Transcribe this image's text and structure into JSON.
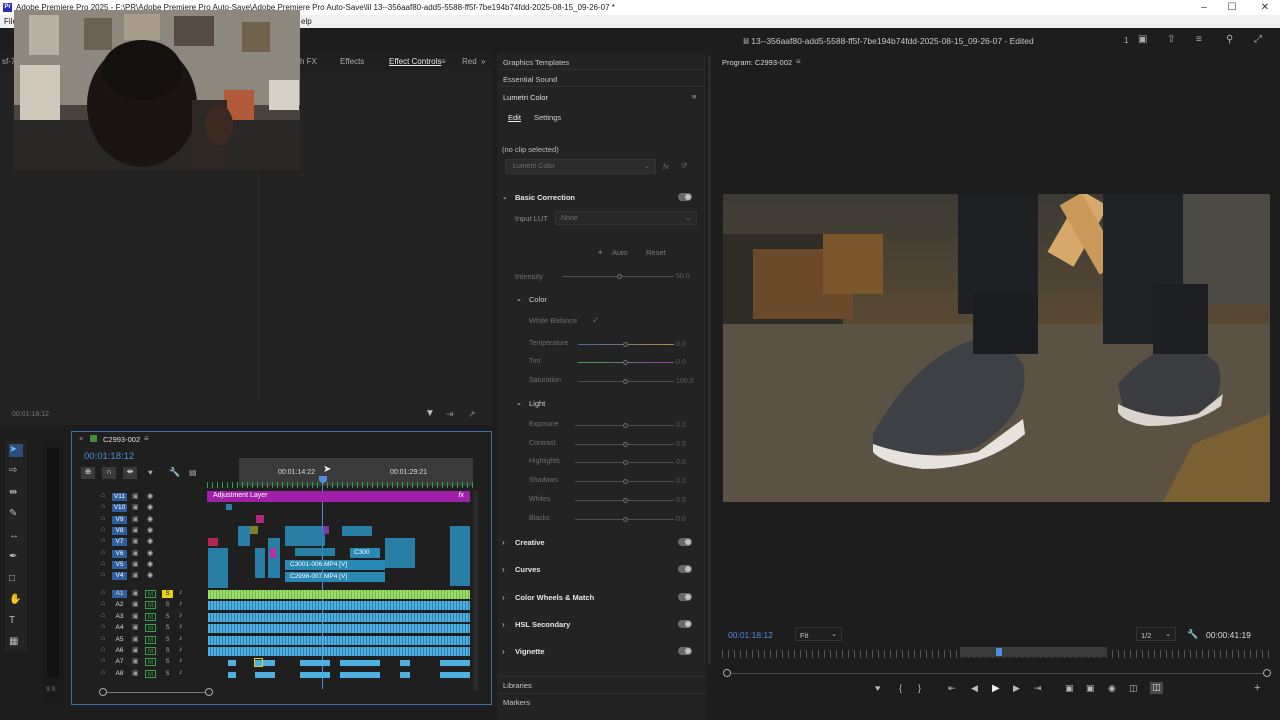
{
  "window": {
    "title": "Adobe Premiere Pro 2025 - F:\\PR\\Adobe Premiere Pro Auto-Save\\Adobe Premiere Pro Auto-Save\\lil 13--356aaf80-add5-5588-ff5f-7be194b74fdd-2025-08-15_09-26-07 *",
    "app_icon": "Pr",
    "minimize": "–",
    "maximize": "☐",
    "close": "✕"
  },
  "menu": {
    "file": "File",
    "help": "elp"
  },
  "project": {
    "title": "lil 13--356aaf80-add5-5588-ff5f-7be194b74fdd-2025-08-15_09-26-07 - Edited",
    "workspace_number": "1"
  },
  "left_panel": {
    "tabs": {
      "cut_left": "sf-7b",
      "fx": "h FX",
      "effects": "Effects",
      "effect_controls": "Effect Controls",
      "red": "Red"
    },
    "timecode": "00:01:18:12"
  },
  "lumetri": {
    "tab_graphics": "Graphics Templates",
    "tab_sound": "Essential Sound",
    "title": "Lumetri Color",
    "tab_edit": "Edit",
    "tab_settings": "Settings",
    "no_clip": "(no clip selected)",
    "dropdown": "Lumetri Color",
    "basic_correction": "Basic Correction",
    "input_lut_label": "Input LUT",
    "input_lut_value": "None",
    "auto": "Auto",
    "reset": "Reset",
    "intensity_label": "Intensity",
    "intensity_value": "50.0",
    "color_section": "Color",
    "white_balance": "White Balance",
    "color_sliders": [
      {
        "label": "Temperature",
        "value": "0.0"
      },
      {
        "label": "Tint",
        "value": "0.0"
      },
      {
        "label": "Saturation",
        "value": "100.0"
      }
    ],
    "light_section": "Light",
    "light_sliders": [
      {
        "label": "Exposure",
        "value": "0.0"
      },
      {
        "label": "Contrast",
        "value": "0.0"
      },
      {
        "label": "Highlights",
        "value": "0.0"
      },
      {
        "label": "Shadows",
        "value": "0.0"
      },
      {
        "label": "Whites",
        "value": "0.0"
      },
      {
        "label": "Blacks",
        "value": "0.0"
      }
    ],
    "sections": [
      "Creative",
      "Curves",
      "Color Wheels & Match",
      "HSL Secondary",
      "Vignette"
    ],
    "libraries": "Libraries",
    "markers": "Markers"
  },
  "program": {
    "title": "Program: C2993-002",
    "timecode": "00:01:18:12",
    "fit": "Fit",
    "resolution": "1/2",
    "duration": "00:00:41:19"
  },
  "timeline": {
    "sequence": "C2993-002",
    "timecode": "00:01:18:12",
    "ruler_1": "00:01:14:22",
    "ruler_2": "00:01:29:21",
    "adjustment_layer": "Adjustment Layer",
    "fx": "fx",
    "video_tracks": [
      "V11",
      "V10",
      "V9",
      "V8",
      "V7",
      "V6",
      "V5",
      "V4"
    ],
    "audio_tracks": [
      "A1",
      "A2",
      "A3",
      "A4",
      "A5",
      "A6",
      "A7",
      "A8"
    ],
    "clip_c3001": "C3001-006.MP4 [V]",
    "clip_c2998": "C2998-007.MP4 [V]",
    "clip_c300": "C300",
    "mute": "M",
    "solo": "S"
  }
}
